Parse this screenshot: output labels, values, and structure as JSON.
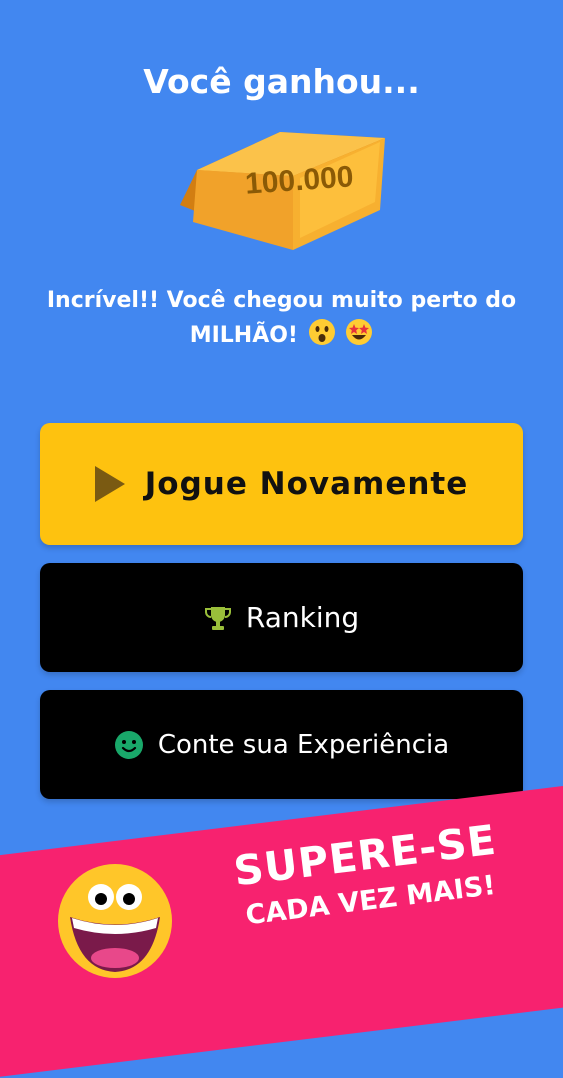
{
  "header": {
    "title": "Você ganhou..."
  },
  "prize": {
    "amount": "100.000",
    "icon": "gold-bar-icon"
  },
  "message": {
    "text": "Incrível!! Você chegou muito perto do MILHÃO!"
  },
  "buttons": {
    "play_label": "Jogue Novamente",
    "ranking_label": "Ranking",
    "experience_label": "Conte sua Experiência"
  },
  "banner": {
    "line1": "SUPERE-SE",
    "line2": "CADA VEZ MAIS!"
  },
  "colors": {
    "background": "#4287f0",
    "play_button": "#fec20f",
    "dark_button": "#000000",
    "banner": "#f7226f",
    "gold": "#f5a623"
  }
}
